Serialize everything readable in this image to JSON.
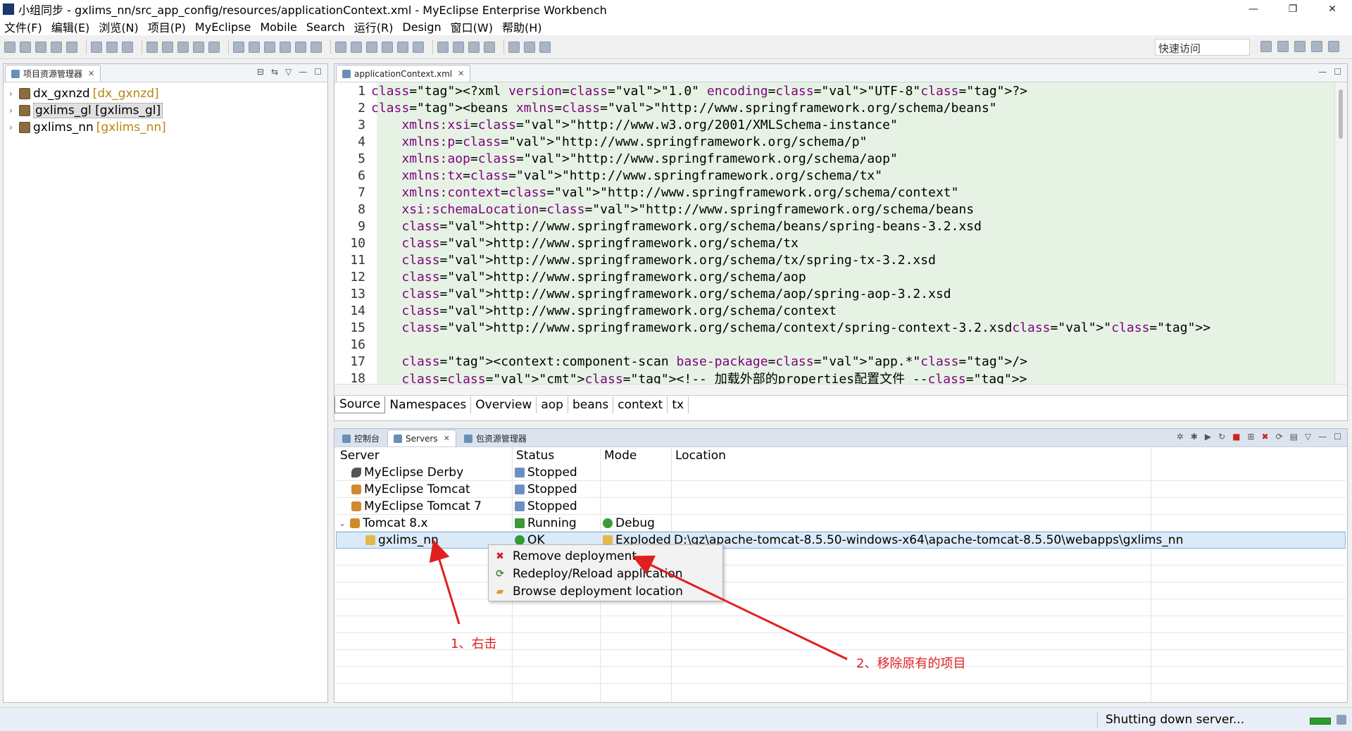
{
  "window": {
    "title": "小组同步 - gxlims_nn/src_app_config/resources/applicationContext.xml - MyEclipse Enterprise Workbench",
    "minimize": "—",
    "maximize": "❐",
    "close": "✕"
  },
  "menu": [
    "文件(F)",
    "编辑(E)",
    "浏览(N)",
    "项目(P)",
    "MyEclipse",
    "Mobile",
    "Search",
    "运行(R)",
    "Design",
    "窗口(W)",
    "帮助(H)"
  ],
  "toolbar": {
    "quick_access_placeholder": "快速访问"
  },
  "project_explorer": {
    "tab_label": "项目资源管理器",
    "projects": [
      {
        "name": "dx_gxnzd",
        "decoration": "[dx_gxnzd]",
        "selected": false
      },
      {
        "name": "gxlims_gl [gxlims_gl]",
        "decoration": "",
        "selected": true
      },
      {
        "name": "gxlims_nn",
        "decoration": "[gxlims_nn]",
        "selected": false
      }
    ]
  },
  "editor": {
    "tab_label": "applicationContext.xml",
    "lines": [
      {
        "n": "1",
        "code": "<?xml version=\"1.0\" encoding=\"UTF-8\"?>"
      },
      {
        "n": "2",
        "code": "<beans xmlns=\"http://www.springframework.org/schema/beans\""
      },
      {
        "n": "3",
        "code": "    xmlns:xsi=\"http://www.w3.org/2001/XMLSchema-instance\""
      },
      {
        "n": "4",
        "code": "    xmlns:p=\"http://www.springframework.org/schema/p\""
      },
      {
        "n": "5",
        "code": "    xmlns:aop=\"http://www.springframework.org/schema/aop\""
      },
      {
        "n": "6",
        "code": "    xmlns:tx=\"http://www.springframework.org/schema/tx\""
      },
      {
        "n": "7",
        "code": "    xmlns:context=\"http://www.springframework.org/schema/context\""
      },
      {
        "n": "8",
        "code": "    xsi:schemaLocation=\"http://www.springframework.org/schema/beans"
      },
      {
        "n": "9",
        "code": "    http://www.springframework.org/schema/beans/spring-beans-3.2.xsd"
      },
      {
        "n": "10",
        "code": "    http://www.springframework.org/schema/tx"
      },
      {
        "n": "11",
        "code": "    http://www.springframework.org/schema/tx/spring-tx-3.2.xsd"
      },
      {
        "n": "12",
        "code": "    http://www.springframework.org/schema/aop"
      },
      {
        "n": "13",
        "code": "    http://www.springframework.org/schema/aop/spring-aop-3.2.xsd"
      },
      {
        "n": "14",
        "code": "    http://www.springframework.org/schema/context"
      },
      {
        "n": "15",
        "code": "    http://www.springframework.org/schema/context/spring-context-3.2.xsd\">"
      },
      {
        "n": "16",
        "code": ""
      },
      {
        "n": "17",
        "code": "    <context:component-scan base-package=\"app.*\"/>"
      },
      {
        "n": "18",
        "code": "    <!-- 加载外部的properties配置文件 -->"
      }
    ],
    "bottom_tabs": [
      "Source",
      "Namespaces",
      "Overview",
      "aop",
      "beans",
      "context",
      "tx"
    ]
  },
  "servers_panel": {
    "tabs": [
      "控制台",
      "Servers",
      "包资源管理器"
    ],
    "columns": [
      "Server",
      "Status",
      "Mode",
      "Location"
    ],
    "rows": [
      {
        "server": "MyEclipse Derby",
        "status": "Stopped",
        "mode": "",
        "location": "",
        "icon": "derby-icon"
      },
      {
        "server": "MyEclipse Tomcat",
        "status": "Stopped",
        "mode": "",
        "location": "",
        "icon": "tomcat-icon"
      },
      {
        "server": "MyEclipse Tomcat 7",
        "status": "Stopped",
        "mode": "",
        "location": "",
        "icon": "tomcat-icon"
      },
      {
        "server": "Tomcat  8.x",
        "status": "Running",
        "mode": "Debug",
        "location": "",
        "icon": "tomcat-icon"
      },
      {
        "server": "gxlims_nn",
        "status": "OK",
        "mode": "Exploded",
        "location": "D:\\gz\\apache-tomcat-8.5.50-windows-x64\\apache-tomcat-8.5.50\\webapps\\gxlims_nn",
        "icon": "deployment-icon"
      }
    ]
  },
  "context_menu": {
    "items": [
      "Remove deployment",
      "Redeploy/Reload application",
      "Browse deployment location"
    ]
  },
  "annotations": {
    "step1": "1、右击",
    "step2": "2、移除原有的项目",
    "color": "#e02020"
  },
  "status_bar": {
    "message": "Shutting down server..."
  }
}
